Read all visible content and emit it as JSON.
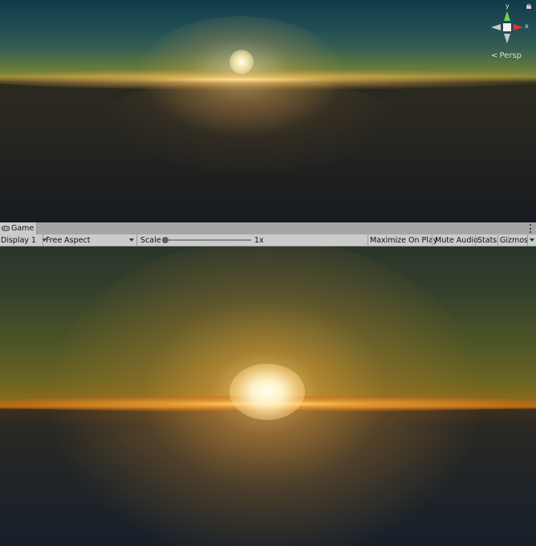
{
  "scene": {
    "projection_label": "Persp",
    "gizmo": {
      "y_axis_label": "y",
      "x_axis_label": "x",
      "colors": {
        "y": "#6cd24a",
        "x": "#e0372c",
        "neutral": "#c9c9c9",
        "center": "#f2f2f2"
      }
    }
  },
  "game_panel": {
    "tab_label": "Game",
    "toolbar": {
      "display": "Display 1",
      "aspect": "Free Aspect",
      "scale_label": "Scale",
      "scale_value": "1x",
      "maximize_on_play": "Maximize On Play",
      "mute_audio": "Mute Audio",
      "stats": "Stats",
      "gizmos": "Gizmos"
    }
  }
}
